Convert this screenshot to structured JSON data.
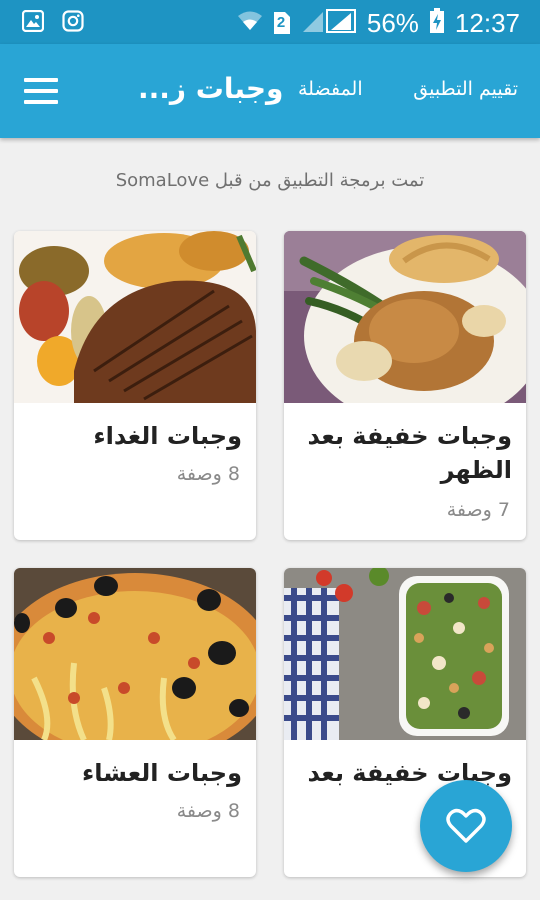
{
  "status_bar": {
    "battery": "56%",
    "time": "12:37",
    "sim_badge": "2",
    "left_icons": [
      "gallery-icon",
      "instagram-icon"
    ],
    "right_icons": [
      "wifi-icon",
      "sim-icon",
      "signal-icon",
      "battery-icon"
    ]
  },
  "app_bar": {
    "title": "وجبات ز...",
    "favorites_label": "المفضلة",
    "rate_label": "تقييم التطبيق",
    "menu_icon": "hamburger-icon"
  },
  "credit": "تمت برمجة التطبيق من قبل SomaLove",
  "categories": [
    {
      "name": "وجبات خفيفة بعد الظهر",
      "count": "7 وصفة",
      "image": "roast-chicken-with-green-beans"
    },
    {
      "name": "وجبات الغداء",
      "count": "8 وصفة",
      "image": "grilled-steak-with-vegetables"
    },
    {
      "name": "وجبات خفيفة بعد",
      "count": "",
      "image": "tuna-salad"
    },
    {
      "name": "وجبات العشاء",
      "count": "8 وصفة",
      "image": "pizza-with-olives"
    }
  ],
  "fab": {
    "icon": "heart-icon"
  },
  "colors": {
    "status_bar": "#1e94c3",
    "app_bar": "#29a5d5",
    "background": "#f0f0f0",
    "fab": "#29a5d5"
  }
}
